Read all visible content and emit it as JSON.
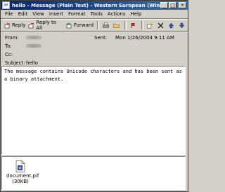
{
  "window": {
    "title": "hello - Message (Plain Text) - Western European (Windows)"
  },
  "menu": [
    "File",
    "Edit",
    "View",
    "Insert",
    "Format",
    "Tools",
    "Actions",
    "Help"
  ],
  "toolbar": {
    "reply": "Reply",
    "reply_all": "Reply to All",
    "forward": "Forward"
  },
  "headers": {
    "from_label": "From:",
    "to_label": "To:",
    "cc_label": "Cc:",
    "subject_label": "Subject:",
    "subject_value": "hello",
    "sent_label": "Sent:",
    "sent_value": "Mon 1/26/2004 9:11 AM"
  },
  "body": {
    "text": "The message contains Unicode characters and has been sent as a binary attachment."
  },
  "attachment": {
    "name": "document.pif",
    "size": "(30KB)"
  },
  "colors": {
    "titlebar_start": "#0a246a",
    "titlebar_end": "#3a6ea5",
    "face": "#d4d0c8"
  }
}
